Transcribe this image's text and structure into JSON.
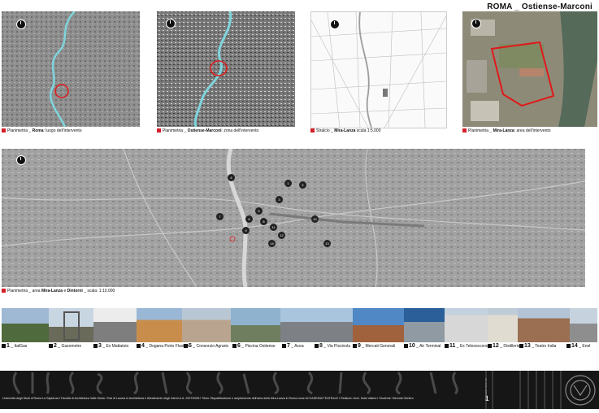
{
  "header": {
    "title": "ROMA _ Ostiense-Marconi"
  },
  "plan_captions": [
    {
      "pre": "Planimetria _ ",
      "bold": "Roma",
      "post": ": luogo dell'intervento"
    },
    {
      "pre": "Planimetria _ ",
      "bold": "Ostiense-Marconi",
      "post": ": zona dell'intervento"
    },
    {
      "pre": "Stralcio _ ",
      "bold": "Mira-Lanza",
      "post": " scala 1:5.000"
    },
    {
      "pre": "Planimetria _ ",
      "bold": "Mira-Lanza",
      "post": ": area dell'intervento"
    }
  ],
  "big_map": {
    "caption_pre": "Planimetria _ area ",
    "caption_bold1": "Mira-Lanza",
    "caption_mid": " e ",
    "caption_bold2": "Dintorni",
    "caption_post": " _ scala: 1:10.000"
  },
  "map_points": [
    "1",
    "2",
    "3",
    "4",
    "5",
    "6",
    "7",
    "8",
    "9",
    "10",
    "11",
    "12",
    "13",
    "14"
  ],
  "photos": [
    {
      "num": "1",
      "name": "ItalGas"
    },
    {
      "num": "2",
      "name": "Gazometro"
    },
    {
      "num": "3",
      "name": "Ex Mattatoio"
    },
    {
      "num": "4",
      "name": "Dogana Porto Fluviale"
    },
    {
      "num": "5",
      "name": "Consorzio Agrario"
    },
    {
      "num": "6",
      "name": "Piscina Ostiense"
    },
    {
      "num": "7",
      "name": "Acea"
    },
    {
      "num": "8",
      "name": "Via Piscinola"
    },
    {
      "num": "9",
      "name": "Mercati Generali"
    },
    {
      "num": "10",
      "name": "Air Terminal"
    },
    {
      "num": "11",
      "name": "Ex Telesoccorso"
    },
    {
      "num": "12",
      "name": "Distilleria"
    },
    {
      "num": "13",
      "name": "Teatro India"
    },
    {
      "num": "14",
      "name": "Enel"
    }
  ],
  "footer": {
    "note": "Università degli Studi di Roma La Sapienza  I  Facoltà di Architettura Valle Giulia  I  Tesi di Laurea in Architettura e Allestimento degli interni A.A. 2007/2008  I  Titolo: Riqualificazione e ampliamento dell'area della Mira-Lanza in Roma come ACCADEMIA TEATRALE  I  Relatore: Arch. Nota Valerio  I  Studente: Memola Oliviero",
    "page_number": "1",
    "vertical_label": "Inquadramento"
  }
}
